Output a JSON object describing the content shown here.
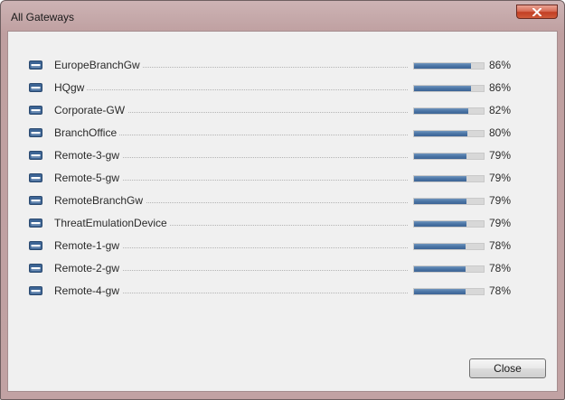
{
  "window": {
    "title": "All Gateways"
  },
  "gateways": [
    {
      "name": "EuropeBranchGw",
      "percent_label": "86%",
      "level": 86
    },
    {
      "name": "HQgw",
      "percent_label": "86%",
      "level": 86
    },
    {
      "name": "Corporate-GW",
      "percent_label": "82%",
      "level": 82
    },
    {
      "name": "BranchOffice",
      "percent_label": "80%",
      "level": 80
    },
    {
      "name": "Remote-3-gw",
      "percent_label": "79%",
      "level": 79
    },
    {
      "name": "Remote-5-gw",
      "percent_label": "79%",
      "level": 79
    },
    {
      "name": "RemoteBranchGw",
      "percent_label": "79%",
      "level": 79
    },
    {
      "name": "ThreatEmulationDevice",
      "percent_label": "79%",
      "level": 79
    },
    {
      "name": "Remote-1-gw",
      "percent_label": "78%",
      "level": 78
    },
    {
      "name": "Remote-2-gw",
      "percent_label": "78%",
      "level": 78
    },
    {
      "name": "Remote-4-gw",
      "percent_label": "78%",
      "level": 78
    }
  ],
  "footer": {
    "close_label": "Close"
  },
  "icons": {
    "gateway": "gateway-device-icon",
    "window_close": "close-icon"
  },
  "colors": {
    "bar_fill": "#4a74a5",
    "bar_track": "#d8d8d8",
    "window_frame": "#c4a7a8",
    "close_button": "#c23f24"
  }
}
